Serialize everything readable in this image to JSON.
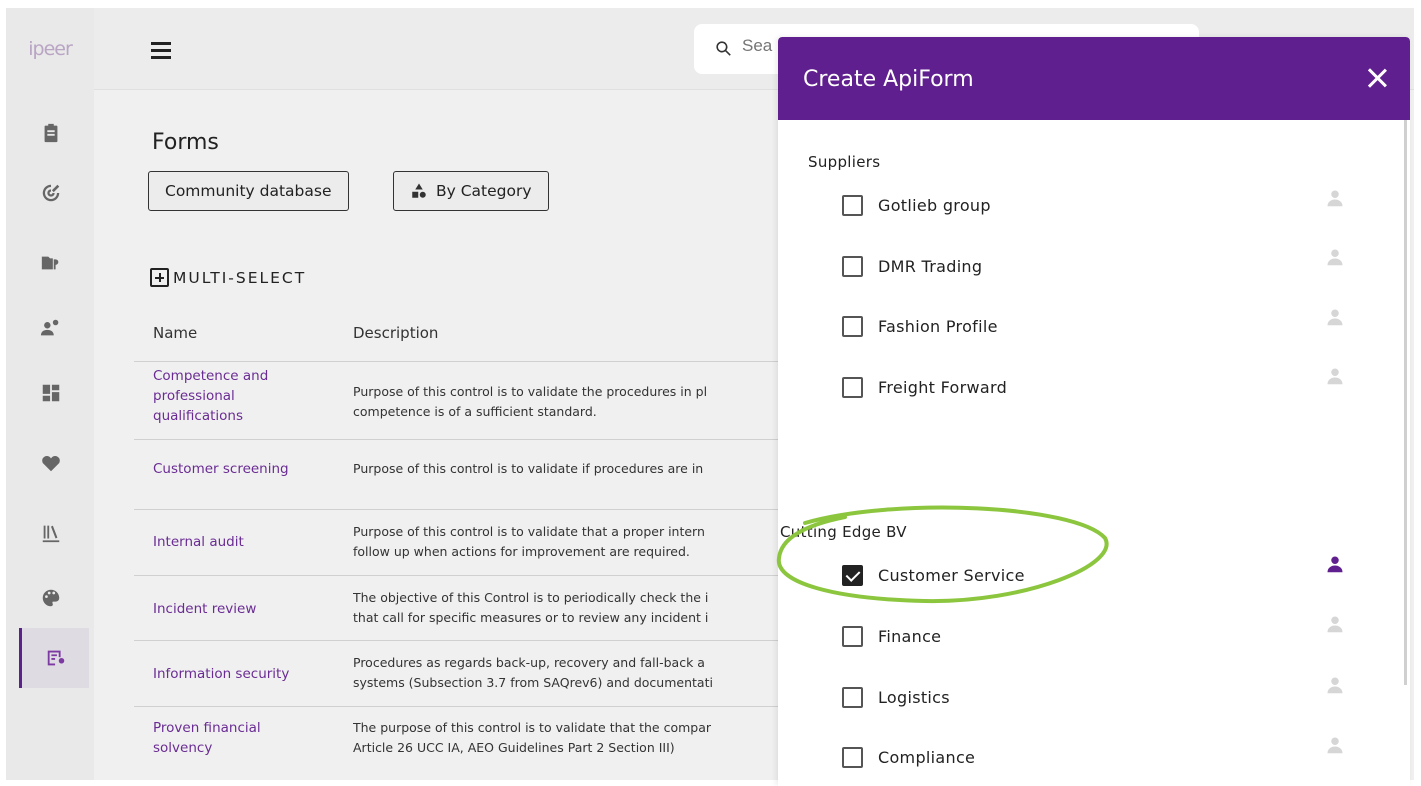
{
  "app": {
    "logo_text": "ipeer"
  },
  "rail": {
    "items": [
      {
        "icon": "clipboard-icon"
      },
      {
        "icon": "target-icon"
      },
      {
        "icon": "folder-share-icon"
      },
      {
        "icon": "users-gear-icon"
      },
      {
        "icon": "dashboard-icon"
      },
      {
        "icon": "heart-alert-icon"
      },
      {
        "icon": "library-icon"
      },
      {
        "icon": "palette-icon"
      },
      {
        "icon": "form-settings-icon",
        "active": true
      }
    ]
  },
  "header": {
    "search_placeholder": "Sea"
  },
  "page": {
    "title": "Forms",
    "chips": [
      "Community database",
      "By Category"
    ],
    "multi_select": "MULTI-SELECT",
    "columns": [
      "Name",
      "Description"
    ],
    "rows": [
      {
        "name": "Competence and professional qualifications",
        "desc1": "Purpose of this control is to validate the procedures in pl",
        "desc2": "competence is of a sufficient standard."
      },
      {
        "name": "Customer screening",
        "desc1": "Purpose of this control is to validate if procedures are in",
        "desc2": ""
      },
      {
        "name": "Internal audit",
        "desc1": "Purpose of this control is to validate that a proper intern",
        "desc2": "follow up when actions for improvement are required."
      },
      {
        "name": "Incident review",
        "desc1": "The objective of this Control is to periodically check the i",
        "desc2": "that call for specific measures or to review any incident i"
      },
      {
        "name": "Information security",
        "desc1": "Procedures as regards back-up, recovery and fall-back a",
        "desc2": "systems (Subsection 3.7 from SAQrev6) and documentati"
      },
      {
        "name": "Proven financial solvency",
        "desc1": "The purpose of this control is to validate that the compar",
        "desc2": "Article 26 UCC IA, AEO Guidelines Part 2 Section III)"
      }
    ]
  },
  "modal": {
    "title": "Create ApiForm",
    "groups": [
      {
        "label": "Suppliers",
        "options": [
          {
            "label": "Gotlieb group",
            "checked": false
          },
          {
            "label": "DMR Trading",
            "checked": false
          },
          {
            "label": "Fashion Profile",
            "checked": false
          },
          {
            "label": "Freight Forward",
            "checked": false
          }
        ]
      },
      {
        "label": "Cutting Edge BV",
        "options": [
          {
            "label": "Customer Service",
            "checked": true
          },
          {
            "label": "Finance",
            "checked": false
          },
          {
            "label": "Logistics",
            "checked": false
          },
          {
            "label": "Compliance",
            "checked": false
          }
        ]
      }
    ]
  },
  "colors": {
    "brand": "#5f1f8e",
    "link": "#6a2c93",
    "highlight_annotation": "#8cc63f"
  }
}
